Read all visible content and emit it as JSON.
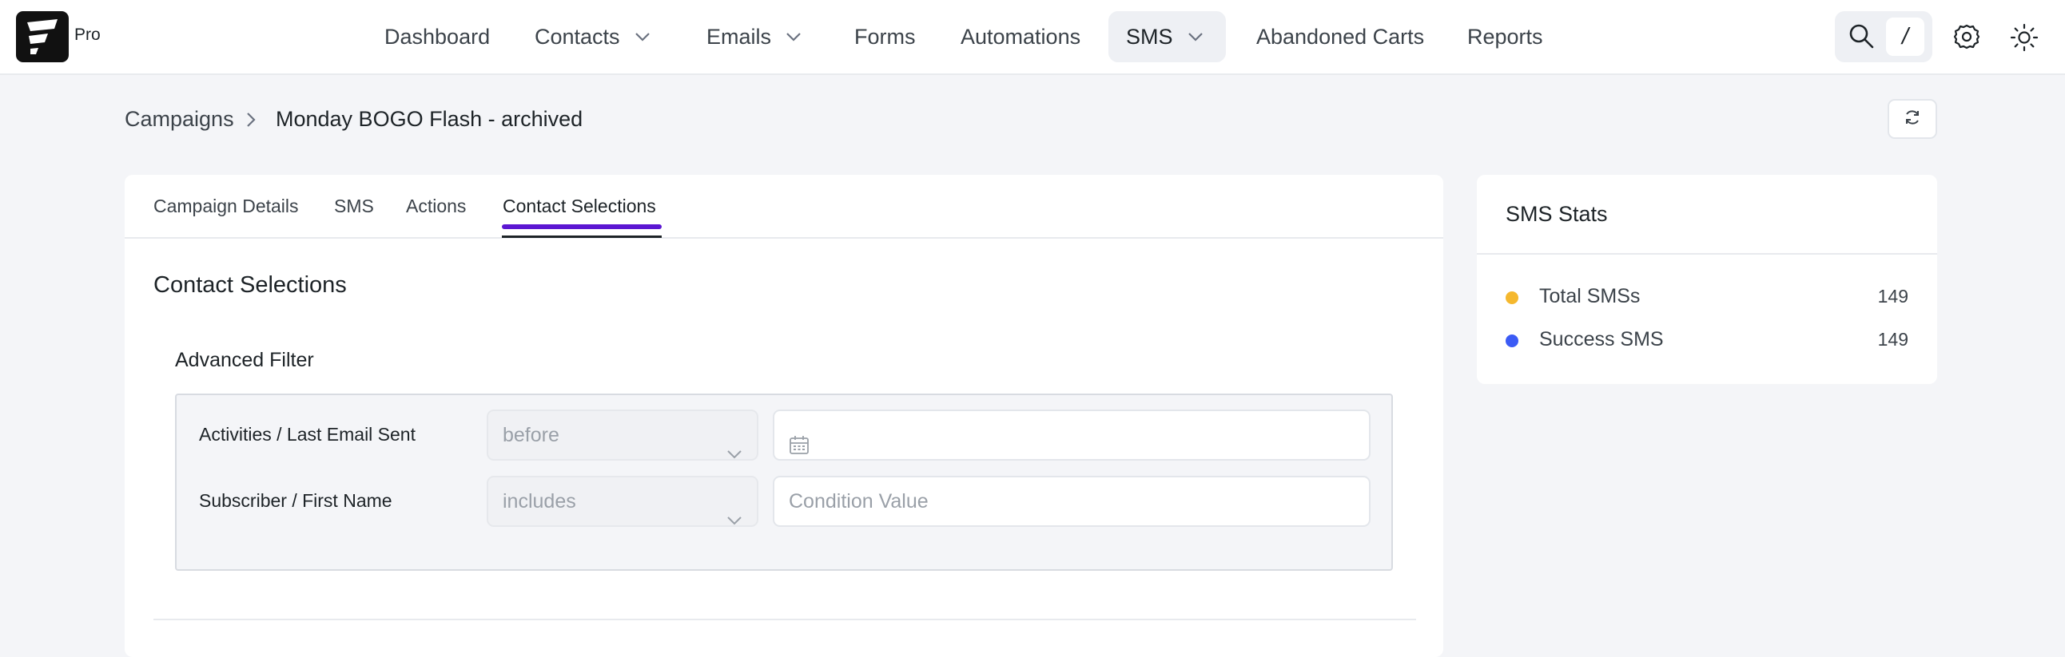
{
  "app": {
    "badge": "Pro"
  },
  "nav": {
    "items": [
      {
        "label": "Dashboard"
      },
      {
        "label": "Contacts"
      },
      {
        "label": "Emails"
      },
      {
        "label": "Forms"
      },
      {
        "label": "Automations"
      },
      {
        "label": "SMS"
      },
      {
        "label": "Abandoned Carts"
      },
      {
        "label": "Reports"
      }
    ],
    "active": "SMS",
    "search_shortcut": "/"
  },
  "icons": {
    "logo": "fluentcrm-logo-icon",
    "search": "search-icon",
    "settings": "gear-icon",
    "theme": "sun-icon",
    "refresh": "refresh-icon",
    "dropdown": "chevron-down-icon",
    "breadcrumb_separator": "chevron-right-icon",
    "calendar": "calendar-icon"
  },
  "breadcrumb": {
    "parent": "Campaigns",
    "current": "Monday BOGO Flash - archived"
  },
  "tabs": [
    {
      "label": "Campaign Details"
    },
    {
      "label": "SMS"
    },
    {
      "label": "Actions"
    },
    {
      "label": "Contact Selections"
    }
  ],
  "active_tab": "Contact Selections",
  "section": {
    "title": "Contact Selections",
    "filter_title": "Advanced Filter",
    "filters": [
      {
        "label": "Activities / Last Email Sent",
        "operator": "before",
        "value": "",
        "value_placeholder": ""
      },
      {
        "label": "Subscriber / First Name",
        "operator": "includes",
        "value": "",
        "value_placeholder": "Condition Value"
      }
    ]
  },
  "stats": {
    "title": "SMS Stats",
    "rows": [
      {
        "label": "Total SMSs",
        "value": "149",
        "color": "#f5b82e"
      },
      {
        "label": "Success SMS",
        "value": "149",
        "color": "#3b5bf5"
      }
    ]
  },
  "colors": {
    "accent": "#5b16d2",
    "background": "#f4f5f8"
  }
}
